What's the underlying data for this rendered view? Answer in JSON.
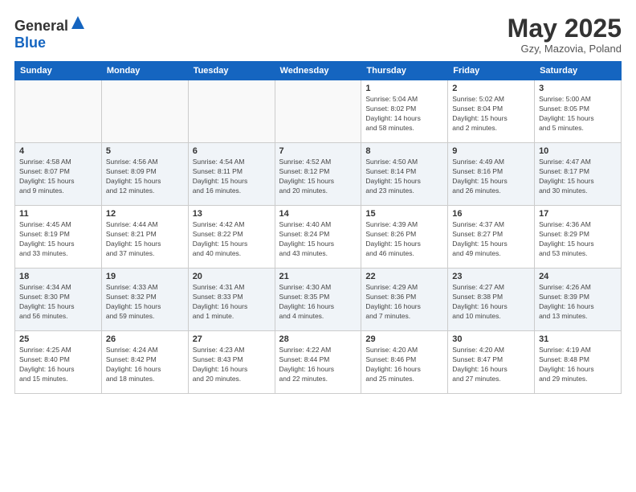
{
  "header": {
    "logo_general": "General",
    "logo_blue": "Blue",
    "month_title": "May 2025",
    "subtitle": "Gzy, Mazovia, Poland"
  },
  "days_of_week": [
    "Sunday",
    "Monday",
    "Tuesday",
    "Wednesday",
    "Thursday",
    "Friday",
    "Saturday"
  ],
  "weeks": [
    [
      {
        "day": "",
        "info": ""
      },
      {
        "day": "",
        "info": ""
      },
      {
        "day": "",
        "info": ""
      },
      {
        "day": "",
        "info": ""
      },
      {
        "day": "1",
        "info": "Sunrise: 5:04 AM\nSunset: 8:02 PM\nDaylight: 14 hours\nand 58 minutes."
      },
      {
        "day": "2",
        "info": "Sunrise: 5:02 AM\nSunset: 8:04 PM\nDaylight: 15 hours\nand 2 minutes."
      },
      {
        "day": "3",
        "info": "Sunrise: 5:00 AM\nSunset: 8:05 PM\nDaylight: 15 hours\nand 5 minutes."
      }
    ],
    [
      {
        "day": "4",
        "info": "Sunrise: 4:58 AM\nSunset: 8:07 PM\nDaylight: 15 hours\nand 9 minutes."
      },
      {
        "day": "5",
        "info": "Sunrise: 4:56 AM\nSunset: 8:09 PM\nDaylight: 15 hours\nand 12 minutes."
      },
      {
        "day": "6",
        "info": "Sunrise: 4:54 AM\nSunset: 8:11 PM\nDaylight: 15 hours\nand 16 minutes."
      },
      {
        "day": "7",
        "info": "Sunrise: 4:52 AM\nSunset: 8:12 PM\nDaylight: 15 hours\nand 20 minutes."
      },
      {
        "day": "8",
        "info": "Sunrise: 4:50 AM\nSunset: 8:14 PM\nDaylight: 15 hours\nand 23 minutes."
      },
      {
        "day": "9",
        "info": "Sunrise: 4:49 AM\nSunset: 8:16 PM\nDaylight: 15 hours\nand 26 minutes."
      },
      {
        "day": "10",
        "info": "Sunrise: 4:47 AM\nSunset: 8:17 PM\nDaylight: 15 hours\nand 30 minutes."
      }
    ],
    [
      {
        "day": "11",
        "info": "Sunrise: 4:45 AM\nSunset: 8:19 PM\nDaylight: 15 hours\nand 33 minutes."
      },
      {
        "day": "12",
        "info": "Sunrise: 4:44 AM\nSunset: 8:21 PM\nDaylight: 15 hours\nand 37 minutes."
      },
      {
        "day": "13",
        "info": "Sunrise: 4:42 AM\nSunset: 8:22 PM\nDaylight: 15 hours\nand 40 minutes."
      },
      {
        "day": "14",
        "info": "Sunrise: 4:40 AM\nSunset: 8:24 PM\nDaylight: 15 hours\nand 43 minutes."
      },
      {
        "day": "15",
        "info": "Sunrise: 4:39 AM\nSunset: 8:26 PM\nDaylight: 15 hours\nand 46 minutes."
      },
      {
        "day": "16",
        "info": "Sunrise: 4:37 AM\nSunset: 8:27 PM\nDaylight: 15 hours\nand 49 minutes."
      },
      {
        "day": "17",
        "info": "Sunrise: 4:36 AM\nSunset: 8:29 PM\nDaylight: 15 hours\nand 53 minutes."
      }
    ],
    [
      {
        "day": "18",
        "info": "Sunrise: 4:34 AM\nSunset: 8:30 PM\nDaylight: 15 hours\nand 56 minutes."
      },
      {
        "day": "19",
        "info": "Sunrise: 4:33 AM\nSunset: 8:32 PM\nDaylight: 15 hours\nand 59 minutes."
      },
      {
        "day": "20",
        "info": "Sunrise: 4:31 AM\nSunset: 8:33 PM\nDaylight: 16 hours\nand 1 minute."
      },
      {
        "day": "21",
        "info": "Sunrise: 4:30 AM\nSunset: 8:35 PM\nDaylight: 16 hours\nand 4 minutes."
      },
      {
        "day": "22",
        "info": "Sunrise: 4:29 AM\nSunset: 8:36 PM\nDaylight: 16 hours\nand 7 minutes."
      },
      {
        "day": "23",
        "info": "Sunrise: 4:27 AM\nSunset: 8:38 PM\nDaylight: 16 hours\nand 10 minutes."
      },
      {
        "day": "24",
        "info": "Sunrise: 4:26 AM\nSunset: 8:39 PM\nDaylight: 16 hours\nand 13 minutes."
      }
    ],
    [
      {
        "day": "25",
        "info": "Sunrise: 4:25 AM\nSunset: 8:40 PM\nDaylight: 16 hours\nand 15 minutes."
      },
      {
        "day": "26",
        "info": "Sunrise: 4:24 AM\nSunset: 8:42 PM\nDaylight: 16 hours\nand 18 minutes."
      },
      {
        "day": "27",
        "info": "Sunrise: 4:23 AM\nSunset: 8:43 PM\nDaylight: 16 hours\nand 20 minutes."
      },
      {
        "day": "28",
        "info": "Sunrise: 4:22 AM\nSunset: 8:44 PM\nDaylight: 16 hours\nand 22 minutes."
      },
      {
        "day": "29",
        "info": "Sunrise: 4:20 AM\nSunset: 8:46 PM\nDaylight: 16 hours\nand 25 minutes."
      },
      {
        "day": "30",
        "info": "Sunrise: 4:20 AM\nSunset: 8:47 PM\nDaylight: 16 hours\nand 27 minutes."
      },
      {
        "day": "31",
        "info": "Sunrise: 4:19 AM\nSunset: 8:48 PM\nDaylight: 16 hours\nand 29 minutes."
      }
    ]
  ]
}
